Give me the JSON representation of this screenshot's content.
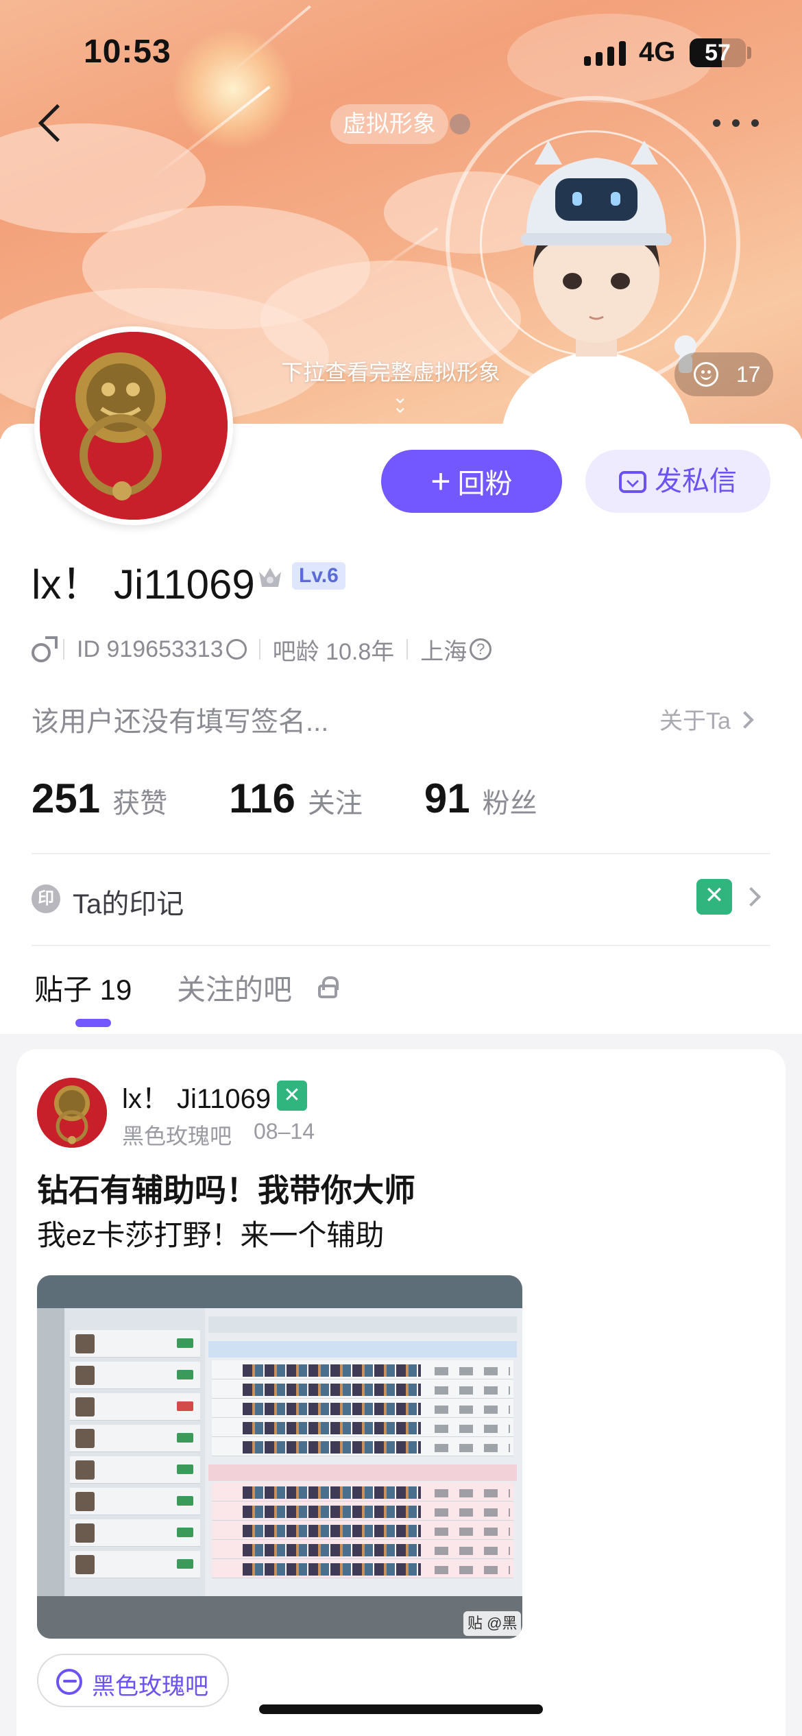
{
  "status_bar": {
    "time": "10:53",
    "network": "4G",
    "battery_level": "57",
    "battery_fraction": 0.57
  },
  "header": {
    "virtual_avatar_chip": "虚拟形象",
    "pull_hint": "下拉查看完整虚拟形象",
    "like_count": "17",
    "icons": [
      "back-icon",
      "more-icon",
      "smile-icon"
    ],
    "colors": {
      "banner_start": "#f6b894",
      "banner_end": "#f2b592"
    }
  },
  "profile": {
    "follow_back_label": "回粉",
    "message_label": "发私信",
    "username": "lx！ Ji11069",
    "level": "Lv.6",
    "gender_icon": "male-icon",
    "id_text": "ID 919653313",
    "bar_age": "吧龄 10.8年",
    "location": "上海",
    "bio": "该用户还没有填写签名...",
    "about_label": "关于Ta",
    "stats": [
      {
        "value": "251",
        "label": "获赞"
      },
      {
        "value": "116",
        "label": "关注"
      },
      {
        "value": "91",
        "label": "粉丝"
      }
    ],
    "mark_icon_text": "印",
    "mark_label": "Ta的印记",
    "colors": {
      "accent": "#7357ff",
      "accent_soft": "#eeeaff",
      "mark_green": "#2fb57d"
    }
  },
  "tabs": {
    "posts_label": "贴子 19",
    "followed_bars_label": "关注的吧"
  },
  "post": {
    "author": "lx！ Ji11069",
    "badge_glyph": "✕",
    "forum": "黑色玫瑰吧",
    "date": "08–14",
    "title": "钻石有辅助吗！我带你大师",
    "body": "我ez卡莎打野！来一个辅助",
    "watermark": "贴 @黑",
    "forum_tag": "黑色玫瑰吧"
  }
}
